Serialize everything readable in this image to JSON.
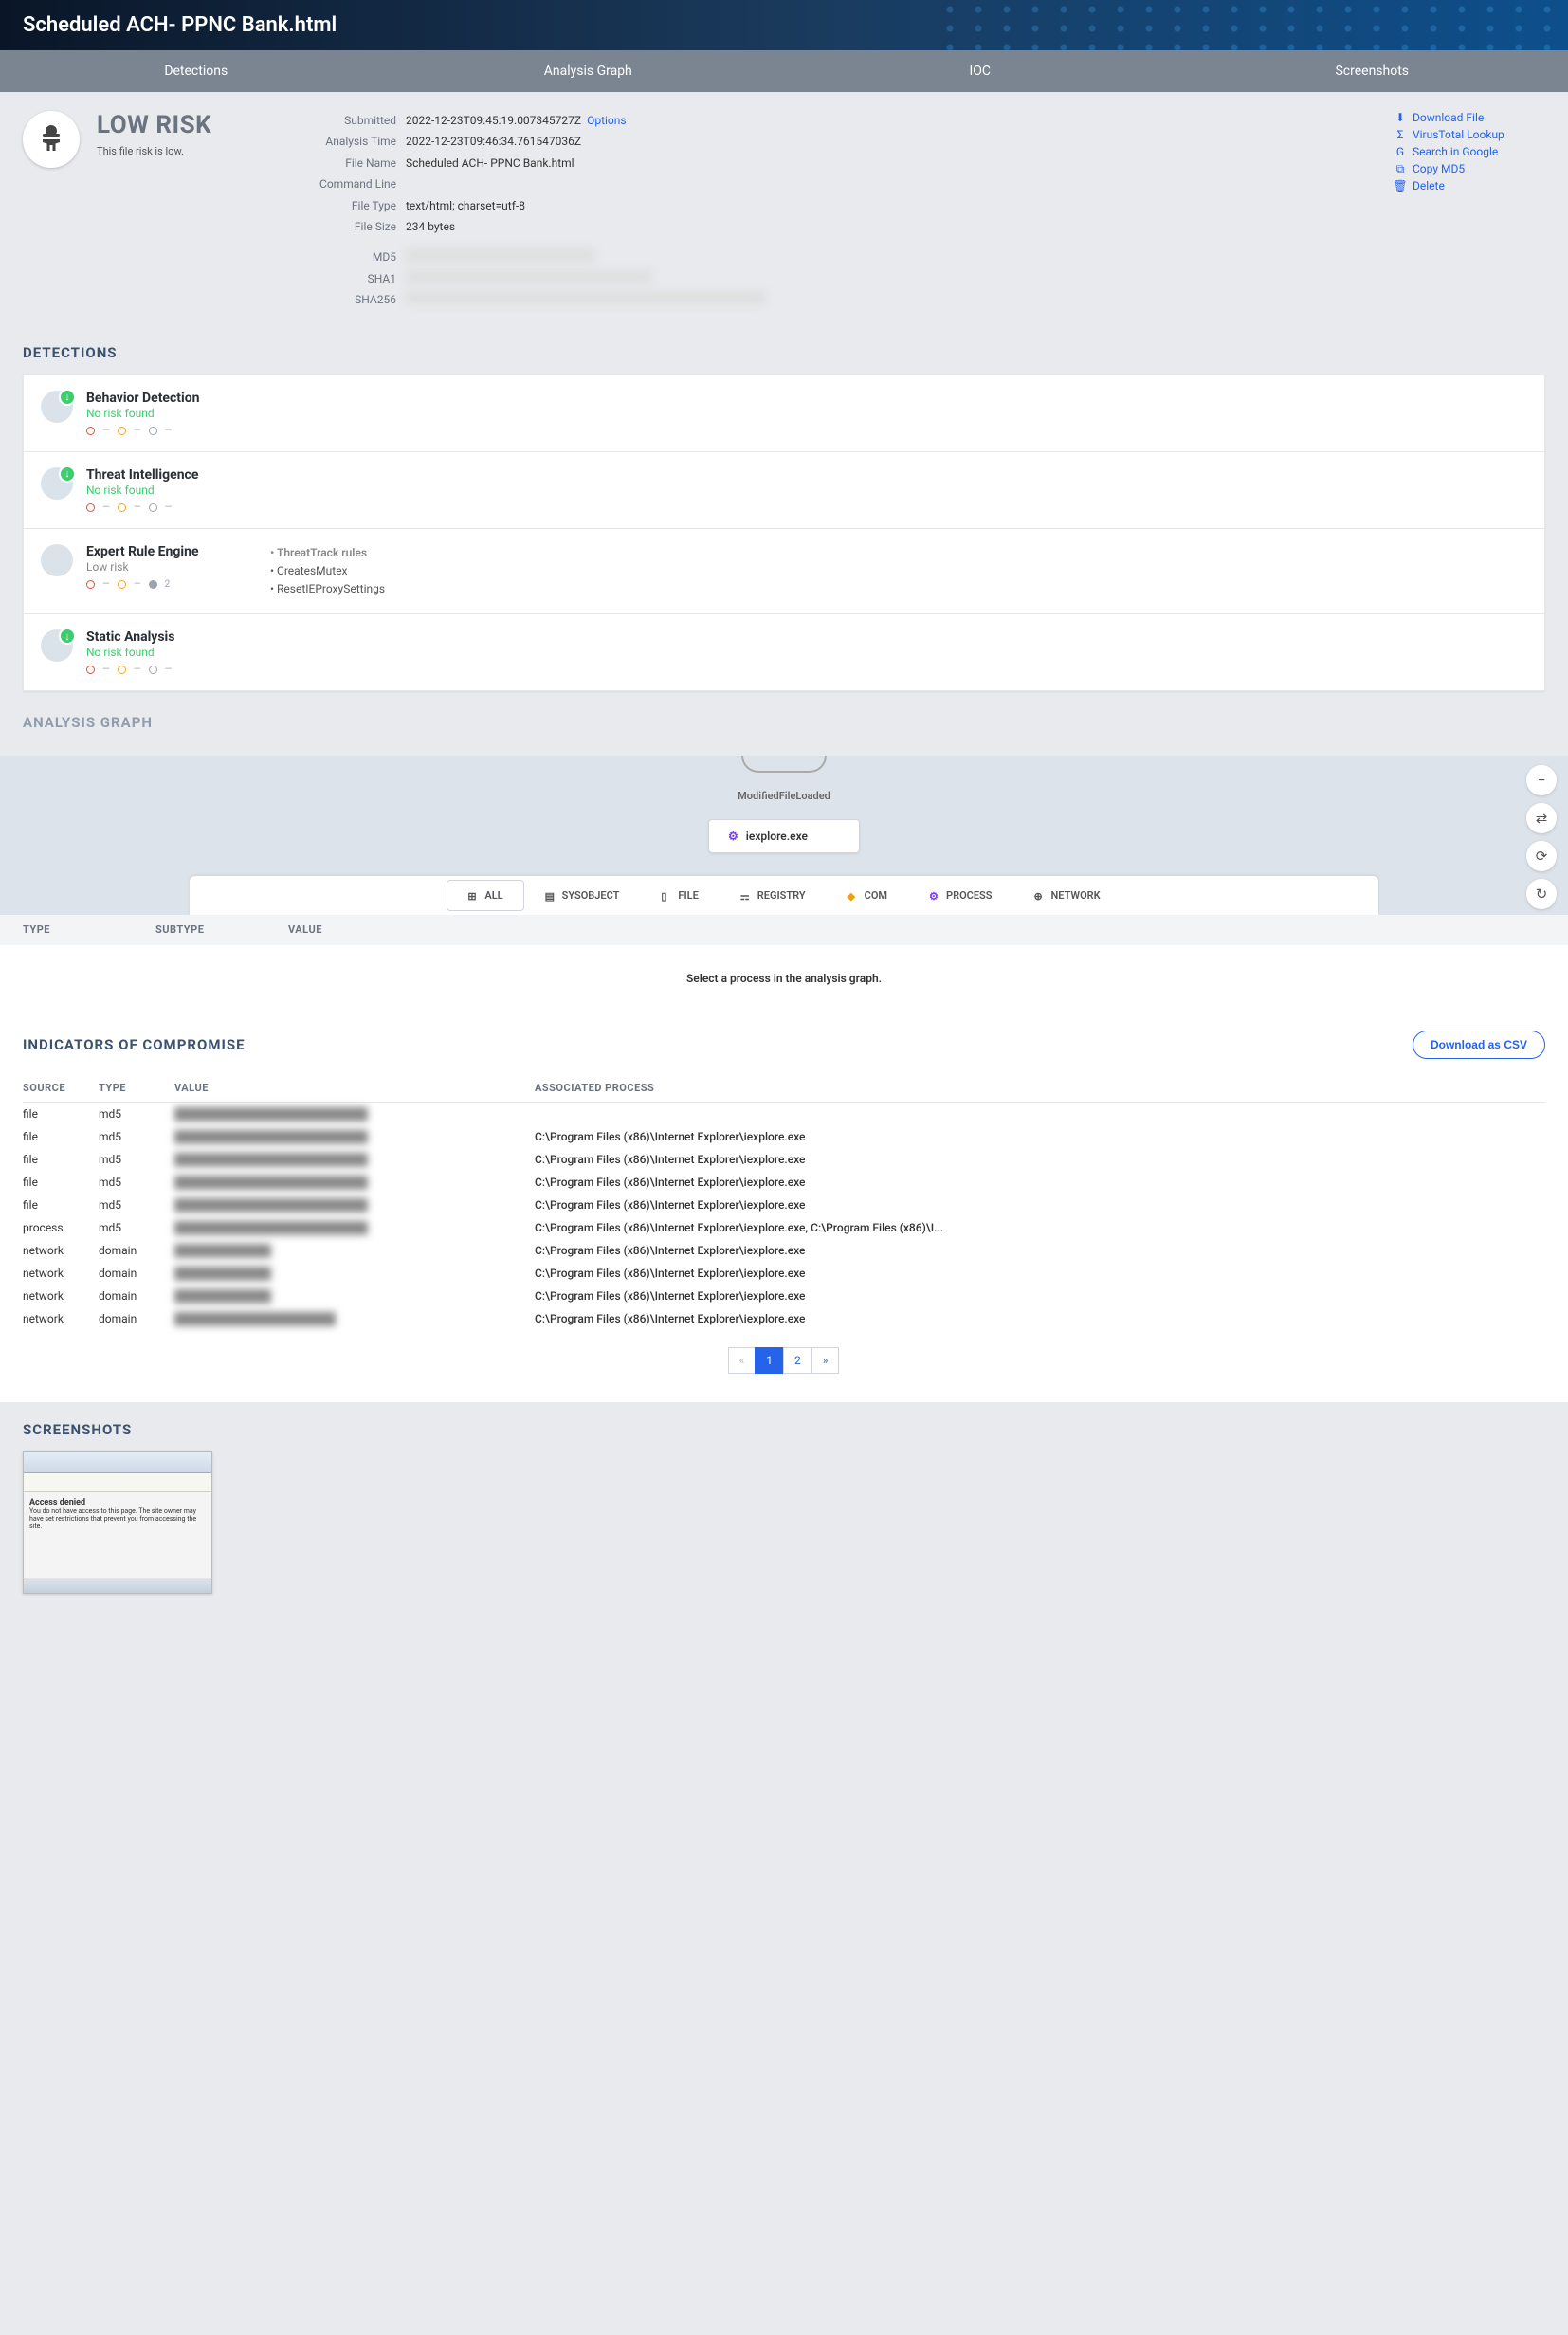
{
  "header": {
    "title": "Scheduled ACH- PPNC Bank.html"
  },
  "tabs": [
    "Detections",
    "Analysis Graph",
    "IOC",
    "Screenshots"
  ],
  "risk": {
    "level": "LOW RISK",
    "description": "This file risk is low."
  },
  "meta": {
    "submitted_label": "Submitted",
    "submitted": "2022-12-23T09:45:19.007345727Z",
    "options": "Options",
    "analysis_time_label": "Analysis Time",
    "analysis_time": "2022-12-23T09:46:34.761547036Z",
    "file_name_label": "File Name",
    "file_name": "Scheduled ACH- PPNC Bank.html",
    "command_line_label": "Command Line",
    "command_line": "",
    "file_type_label": "File Type",
    "file_type": "text/html; charset=utf-8",
    "file_size_label": "File Size",
    "file_size": "234 bytes",
    "md5_label": "MD5",
    "sha1_label": "SHA1",
    "sha256_label": "SHA256"
  },
  "actions": {
    "download": "Download File",
    "virustotal": "VirusTotal Lookup",
    "google": "Search in Google",
    "copy_md5": "Copy MD5",
    "delete": "Delete"
  },
  "sections": {
    "detections": "DETECTIONS",
    "analysis_graph": "ANALYSIS GRAPH",
    "ioc": "INDICATORS OF COMPROMISE",
    "screenshots": "SCREENSHOTS"
  },
  "detections": [
    {
      "name": "Behavior Detection",
      "status": "No risk found",
      "status_class": "ok",
      "extra": null,
      "dots": [
        "r",
        "o",
        "g"
      ],
      "badge": true
    },
    {
      "name": "Threat Intelligence",
      "status": "No risk found",
      "status_class": "ok",
      "extra": null,
      "dots": [
        "r",
        "o",
        "g"
      ],
      "badge": true
    },
    {
      "name": "Expert Rule Engine",
      "status": "Low risk",
      "status_class": "low",
      "extra": {
        "title": "ThreatTrack rules",
        "items": [
          "CreatesMutex",
          "ResetIEProxySettings"
        ]
      },
      "dots": [
        "r",
        "o",
        "g2"
      ],
      "badge": false
    },
    {
      "name": "Static Analysis",
      "status": "No risk found",
      "status_class": "ok",
      "extra": null,
      "dots": [
        "r",
        "o",
        "g"
      ],
      "badge": true
    }
  ],
  "graph": {
    "edge_label": "ModifiedFileLoaded",
    "node": "iexplore.exe",
    "filters": [
      "ALL",
      "SYSOBJECT",
      "FILE",
      "REGISTRY",
      "COM",
      "PROCESS",
      "NETWORK"
    ],
    "columns": [
      "TYPE",
      "SUBTYPE",
      "VALUE"
    ],
    "empty": "Select a process in the analysis graph."
  },
  "ioc": {
    "csv": "Download as CSV",
    "columns": [
      "SOURCE",
      "TYPE",
      "VALUE",
      "ASSOCIATED PROCESS"
    ],
    "rows": [
      {
        "source": "file",
        "type": "md5",
        "value": "████████████████████████",
        "process": ""
      },
      {
        "source": "file",
        "type": "md5",
        "value": "████████████████████████",
        "process": "C:\\Program Files (x86)\\Internet Explorer\\iexplore.exe"
      },
      {
        "source": "file",
        "type": "md5",
        "value": "████████████████████████",
        "process": "C:\\Program Files (x86)\\Internet Explorer\\iexplore.exe"
      },
      {
        "source": "file",
        "type": "md5",
        "value": "████████████████████████",
        "process": "C:\\Program Files (x86)\\Internet Explorer\\iexplore.exe"
      },
      {
        "source": "file",
        "type": "md5",
        "value": "████████████████████████",
        "process": "C:\\Program Files (x86)\\Internet Explorer\\iexplore.exe"
      },
      {
        "source": "process",
        "type": "md5",
        "value": "████████████████████████",
        "process": "C:\\Program Files (x86)\\Internet Explorer\\iexplore.exe, C:\\Program Files (x86)\\I..."
      },
      {
        "source": "network",
        "type": "domain",
        "value": "████████████",
        "process": "C:\\Program Files (x86)\\Internet Explorer\\iexplore.exe"
      },
      {
        "source": "network",
        "type": "domain",
        "value": "████████████",
        "process": "C:\\Program Files (x86)\\Internet Explorer\\iexplore.exe"
      },
      {
        "source": "network",
        "type": "domain",
        "value": "████████████",
        "process": "C:\\Program Files (x86)\\Internet Explorer\\iexplore.exe"
      },
      {
        "source": "network",
        "type": "domain",
        "value": "████████████████████",
        "process": "C:\\Program Files (x86)\\Internet Explorer\\iexplore.exe"
      }
    ],
    "pager": {
      "prev": "«",
      "pages": [
        "1",
        "2"
      ],
      "next": "»",
      "active": 1
    }
  },
  "screenshot": {
    "title": "Access denied",
    "body": "You do not have access to this page. The site owner may have set restrictions that prevent you from accessing the site."
  }
}
